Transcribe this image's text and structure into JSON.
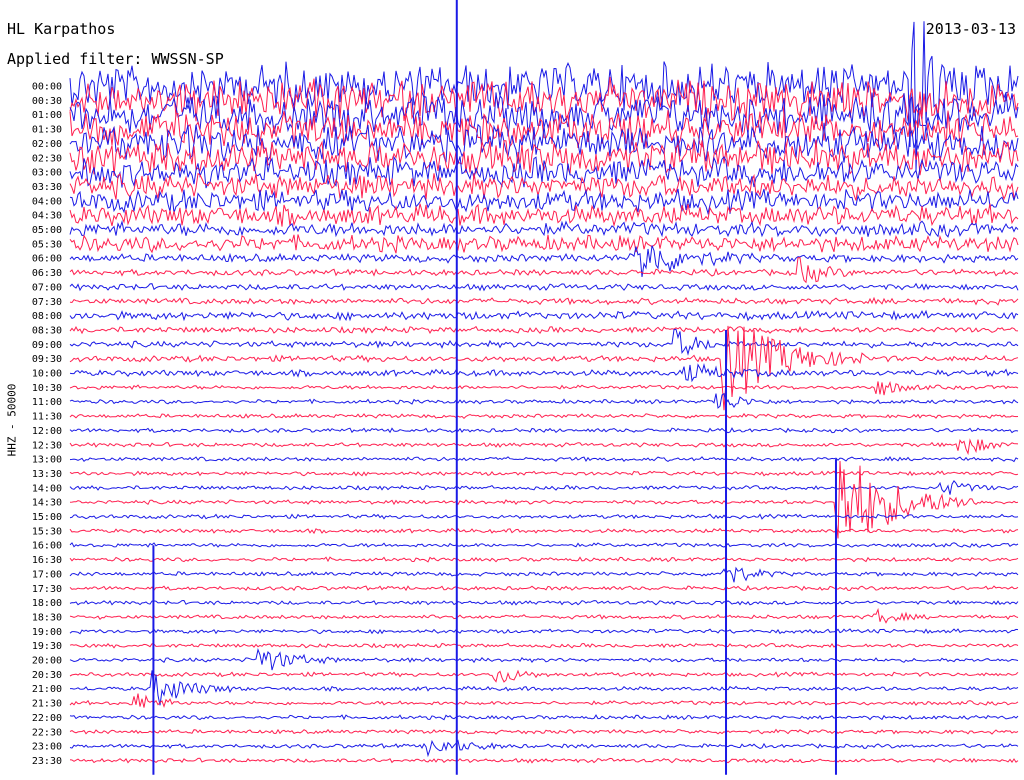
{
  "header": {
    "station": "HL Karpathos",
    "filter": "Applied filter: WWSSN-SP",
    "date": "2013-03-13",
    "channel": "HHZ - 50000"
  },
  "colors": {
    "blue": "#1a1ae6",
    "red": "#ff1f4f"
  },
  "chart_data": {
    "type": "line",
    "title": "HL Karpathos",
    "subtitle": "Applied filter: WWSSN-SP",
    "date": "2013-03-13",
    "ylabel": "HHZ - 50000",
    "row_labels": [
      "00:00",
      "00:30",
      "01:00",
      "01:30",
      "02:00",
      "02:30",
      "03:00",
      "03:30",
      "04:00",
      "04:30",
      "05:00",
      "05:30",
      "06:00",
      "06:30",
      "07:00",
      "07:30",
      "08:00",
      "08:30",
      "09:00",
      "09:30",
      "10:00",
      "10:30",
      "11:00",
      "11:30",
      "12:00",
      "12:30",
      "13:00",
      "13:30",
      "14:00",
      "14:30",
      "15:00",
      "15:30",
      "16:00",
      "16:30",
      "17:00",
      "17:30",
      "18:00",
      "18:30",
      "19:00",
      "19:30",
      "20:00",
      "20:30",
      "21:00",
      "21:30",
      "22:00",
      "22:30",
      "23:00",
      "23:30"
    ],
    "colors": [
      "#1a1ae6",
      "#ff1f4f"
    ],
    "row_noise": [
      22,
      20,
      19,
      18,
      18,
      17,
      14,
      12,
      11,
      10,
      7,
      8,
      4,
      3,
      3,
      3,
      4,
      3,
      3,
      3,
      3,
      2,
      2,
      2,
      2,
      2,
      2,
      2,
      2,
      2,
      2,
      2,
      2,
      2,
      2,
      2,
      2,
      2,
      2,
      2,
      2,
      2,
      2,
      2,
      2,
      2,
      2,
      2
    ],
    "events": [
      {
        "row": 0,
        "x": 0.89,
        "amp": 80,
        "dur": 0.02
      },
      {
        "row": 12,
        "x": 0.6,
        "amp": 22,
        "dur": 0.04
      },
      {
        "row": 13,
        "x": 0.77,
        "amp": 14,
        "dur": 0.02
      },
      {
        "row": 18,
        "x": 0.64,
        "amp": 14,
        "dur": 0.02
      },
      {
        "row": 19,
        "x": 0.69,
        "amp": 50,
        "dur": 0.05
      },
      {
        "row": 20,
        "x": 0.65,
        "amp": 8,
        "dur": 0.04
      },
      {
        "row": 21,
        "x": 0.85,
        "amp": 10,
        "dur": 0.02
      },
      {
        "row": 22,
        "x": 0.68,
        "amp": 14,
        "dur": 0.02
      },
      {
        "row": 25,
        "x": 0.94,
        "amp": 12,
        "dur": 0.02
      },
      {
        "row": 28,
        "x": 0.92,
        "amp": 10,
        "dur": 0.02
      },
      {
        "row": 29,
        "x": 0.81,
        "amp": 60,
        "dur": 0.05
      },
      {
        "row": 34,
        "x": 0.69,
        "amp": 14,
        "dur": 0.02
      },
      {
        "row": 37,
        "x": 0.85,
        "amp": 8,
        "dur": 0.02
      },
      {
        "row": 40,
        "x": 0.2,
        "amp": 14,
        "dur": 0.03
      },
      {
        "row": 41,
        "x": 0.45,
        "amp": 10,
        "dur": 0.02
      },
      {
        "row": 42,
        "x": 0.09,
        "amp": 18,
        "dur": 0.03
      },
      {
        "row": 43,
        "x": 0.07,
        "amp": 10,
        "dur": 0.02
      },
      {
        "row": 46,
        "x": 0.38,
        "amp": 10,
        "dur": 0.03
      }
    ],
    "spikes": [
      {
        "x": 0.408,
        "from": 0,
        "to": 48
      },
      {
        "x": 0.692,
        "from": 17,
        "to": 48
      },
      {
        "x": 0.808,
        "from": 26,
        "to": 48
      },
      {
        "x": 0.088,
        "from": 32,
        "to": 48
      }
    ]
  }
}
